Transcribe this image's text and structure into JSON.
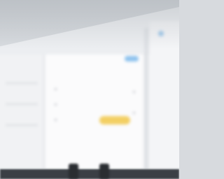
{
  "colors": {
    "accent_blue": "#8fc3ee",
    "highlight_yellow": "#f3cf63",
    "bezel": "#3b3f45"
  }
}
